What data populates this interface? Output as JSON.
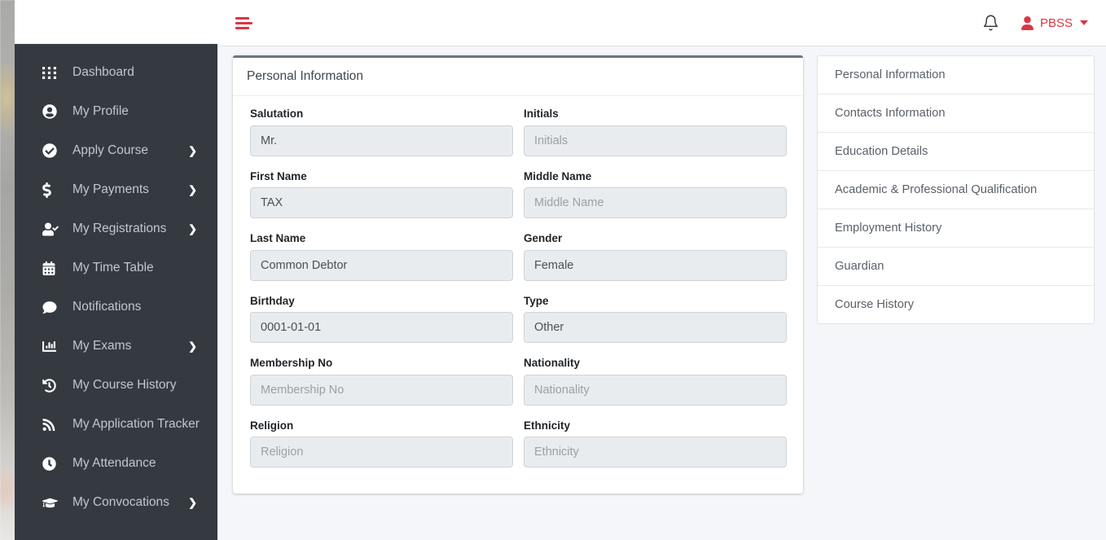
{
  "theme": {
    "sidebar_bg": "#343a40",
    "accent": "#dc3545",
    "content_bg": "#f4f6f9",
    "card_top_border": "#6c757d",
    "input_bg": "#e9ecef"
  },
  "sidebar": {
    "items": [
      {
        "label": "Dashboard",
        "icon": "grid-icon",
        "has_caret": false
      },
      {
        "label": "My Profile",
        "icon": "user-circle-icon",
        "has_caret": false
      },
      {
        "label": "Apply Course",
        "icon": "check-circle-icon",
        "has_caret": true
      },
      {
        "label": "My Payments",
        "icon": "dollar-icon",
        "has_caret": true
      },
      {
        "label": "My Registrations",
        "icon": "user-check-icon",
        "has_caret": true
      },
      {
        "label": "My Time Table",
        "icon": "calendar-icon",
        "has_caret": false
      },
      {
        "label": "Notifications",
        "icon": "comment-icon",
        "has_caret": false
      },
      {
        "label": "My Exams",
        "icon": "chart-bar-icon",
        "has_caret": true
      },
      {
        "label": "My Course History",
        "icon": "history-icon",
        "has_caret": false
      },
      {
        "label": "My Application Tracker",
        "icon": "rss-icon",
        "has_caret": false
      },
      {
        "label": "My Attendance",
        "icon": "clock-icon",
        "has_caret": false
      },
      {
        "label": "My Convocations",
        "icon": "graduation-cap-icon",
        "has_caret": true
      }
    ]
  },
  "navbar": {
    "menu_toggle": "hamburger-icon",
    "notifications_icon": "bell-icon",
    "user_icon": "user-icon",
    "user_name": "PBSS",
    "dropdown_icon": "caret-down-icon"
  },
  "form": {
    "title": "Personal Information",
    "rows": [
      [
        {
          "label": "Salutation",
          "value": "Mr.",
          "placeholder": "Salutation",
          "filled": true
        },
        {
          "label": "Initials",
          "value": "",
          "placeholder": "Initials",
          "filled": false
        }
      ],
      [
        {
          "label": "First Name",
          "value": "TAX",
          "placeholder": "First Name",
          "filled": true
        },
        {
          "label": "Middle Name",
          "value": "",
          "placeholder": "Middle Name",
          "filled": false
        }
      ],
      [
        {
          "label": "Last Name",
          "value": "Common Debtor",
          "placeholder": "Last Name",
          "filled": true
        },
        {
          "label": "Gender",
          "value": "Female",
          "placeholder": "Gender",
          "filled": true
        }
      ],
      [
        {
          "label": "Birthday",
          "value": "0001-01-01",
          "placeholder": "Birthday",
          "filled": true
        },
        {
          "label": "Type",
          "value": "Other",
          "placeholder": "Type",
          "filled": true
        }
      ],
      [
        {
          "label": "Membership No",
          "value": "",
          "placeholder": "Membership No",
          "filled": false
        },
        {
          "label": "Nationality",
          "value": "",
          "placeholder": "Nationality",
          "filled": false
        }
      ],
      [
        {
          "label": "Religion",
          "value": "",
          "placeholder": "Religion",
          "filled": false
        },
        {
          "label": "Ethnicity",
          "value": "",
          "placeholder": "Ethnicity",
          "filled": false
        }
      ]
    ]
  },
  "section_list": {
    "items": [
      {
        "label": "Personal Information"
      },
      {
        "label": "Contacts Information"
      },
      {
        "label": "Education Details"
      },
      {
        "label": "Academic & Professional Qualification"
      },
      {
        "label": "Employment History"
      },
      {
        "label": "Guardian"
      },
      {
        "label": "Course History"
      }
    ]
  }
}
